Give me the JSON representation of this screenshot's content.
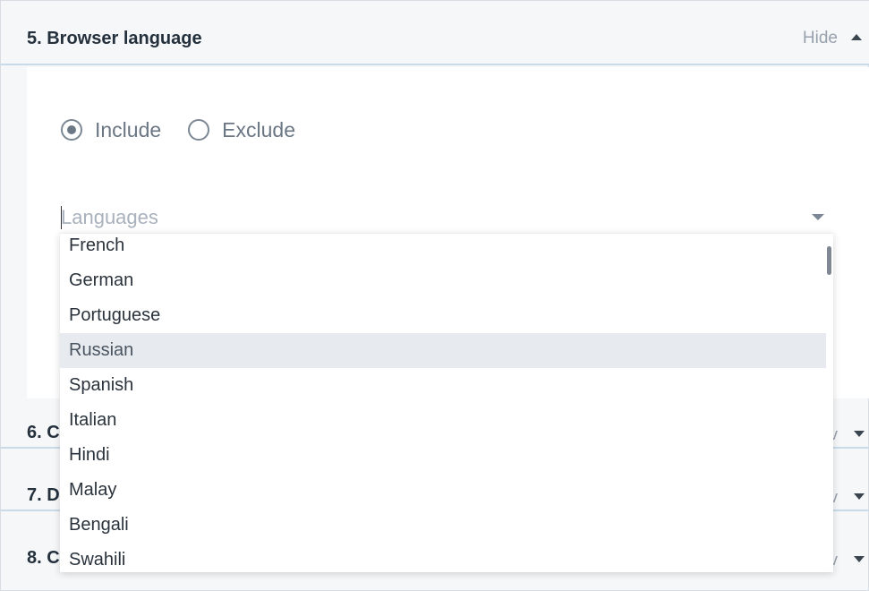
{
  "section5": {
    "title": "5. Browser language",
    "hide_label": "Hide"
  },
  "targeting": {
    "include_label": "Include",
    "exclude_label": "Exclude",
    "selected": "include"
  },
  "languages_field": {
    "placeholder": "Languages",
    "value": ""
  },
  "dropdown": {
    "highlighted": "Russian",
    "options": [
      "French",
      "German",
      "Portuguese",
      "Russian",
      "Spanish",
      "Italian",
      "Hindi",
      "Malay",
      "Bengali",
      "Swahili"
    ]
  },
  "sections_collapsed": [
    {
      "title": "6. C",
      "show_label": "v"
    },
    {
      "title": "7. D",
      "show_label": "v"
    },
    {
      "title": "8. C",
      "show_label": "v"
    }
  ]
}
